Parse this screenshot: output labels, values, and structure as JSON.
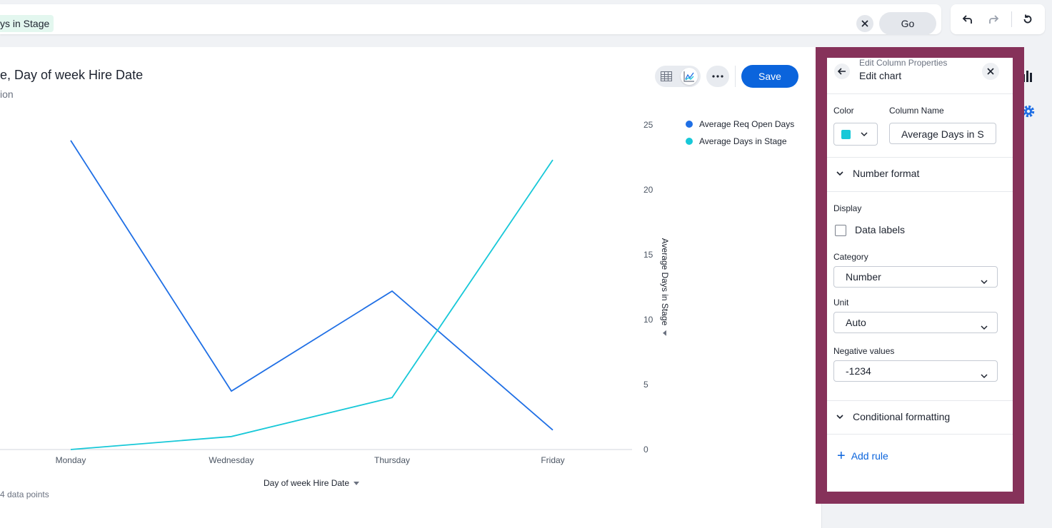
{
  "search": {
    "token": "ys in Stage",
    "go_label": "Go"
  },
  "header": {
    "title": "e, Day of week Hire Date",
    "subtitle": "ion",
    "save_label": "Save"
  },
  "footer": {
    "data_points": "4 data points"
  },
  "chart_data": {
    "type": "line",
    "categories": [
      "Monday",
      "Wednesday",
      "Thursday",
      "Friday"
    ],
    "series": [
      {
        "name": "Average Req Open Days",
        "color": "#1f6fe5",
        "values": [
          null,
          null,
          null,
          null
        ],
        "relative_values": [
          23.8,
          4.5,
          12.2,
          1.5
        ]
      },
      {
        "name": "Average Days in Stage",
        "color": "#17c8d8",
        "values": [
          0,
          1.0,
          4.0,
          22.3
        ]
      }
    ],
    "xlabel": "Day of week Hire Date",
    "ylabel": "Average Days in Stage",
    "y_ticks": [
      "0",
      "5",
      "10",
      "15",
      "20",
      "25"
    ],
    "ylim": [
      0,
      25
    ],
    "legend_position": "top-right"
  },
  "panel": {
    "crumb": "Edit Column Properties",
    "title": "Edit chart",
    "color_label": "Color",
    "color_value": "#17c8d8",
    "column_name_label": "Column Name",
    "column_name_value": "Average Days in S",
    "number_format_label": "Number format",
    "display_label": "Display",
    "data_labels_label": "Data labels",
    "data_labels_checked": false,
    "category_label": "Category",
    "category_value": "Number",
    "unit_label": "Unit",
    "unit_value": "Auto",
    "negative_label": "Negative values",
    "negative_value": "-1234",
    "conditional_label": "Conditional formatting",
    "add_rule_label": "Add rule"
  }
}
